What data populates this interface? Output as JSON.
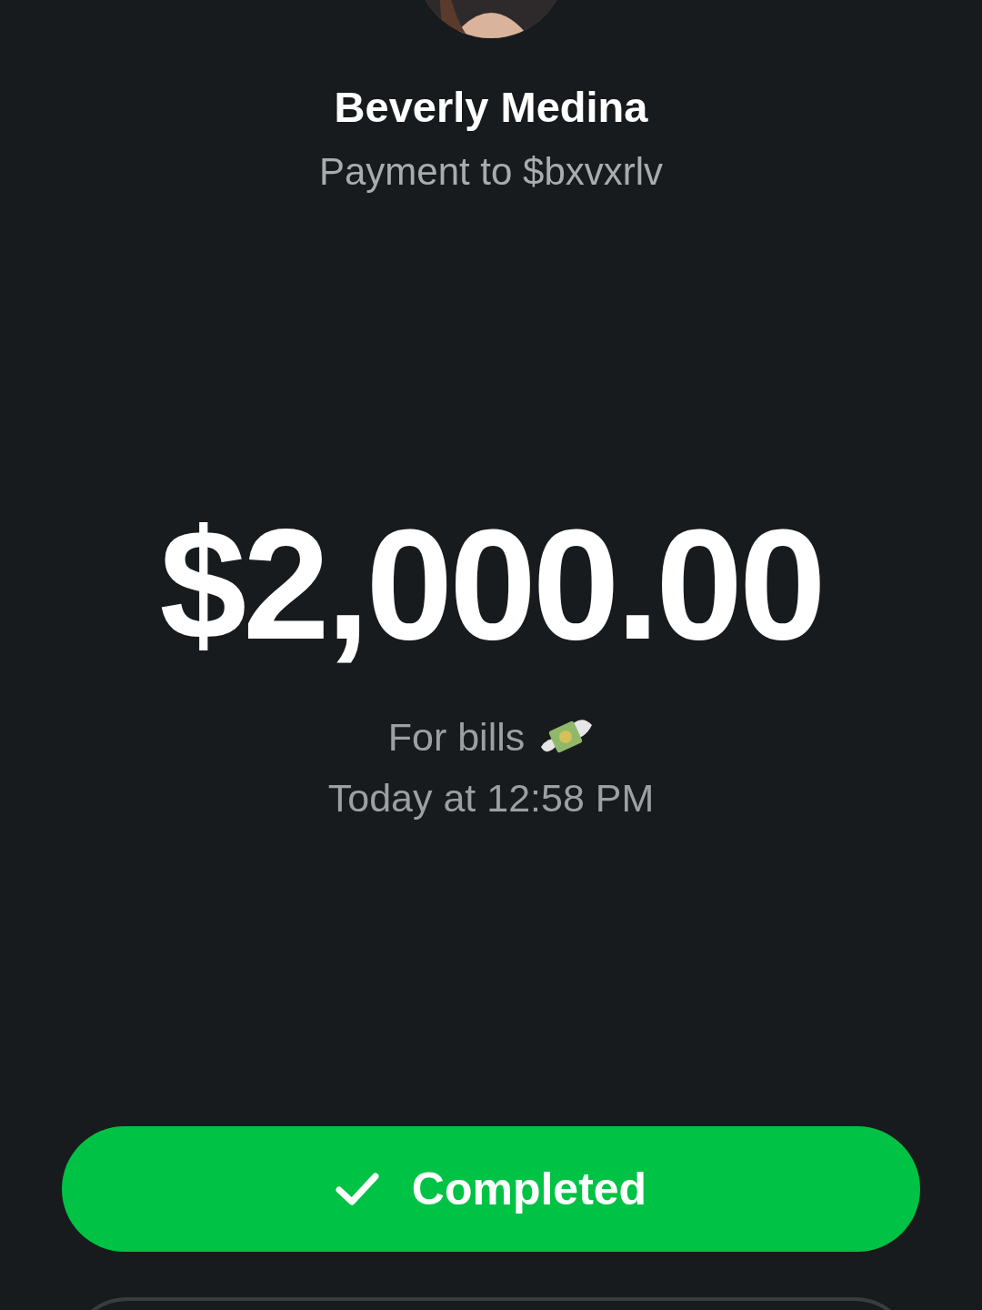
{
  "recipient": {
    "name": "Beverly Medina",
    "subtitle": "Payment to $bxvxrlv"
  },
  "amount": "$2,000.00",
  "note": "For bills",
  "time": "Today at 12:58 PM",
  "status_button": {
    "label": "Completed"
  }
}
